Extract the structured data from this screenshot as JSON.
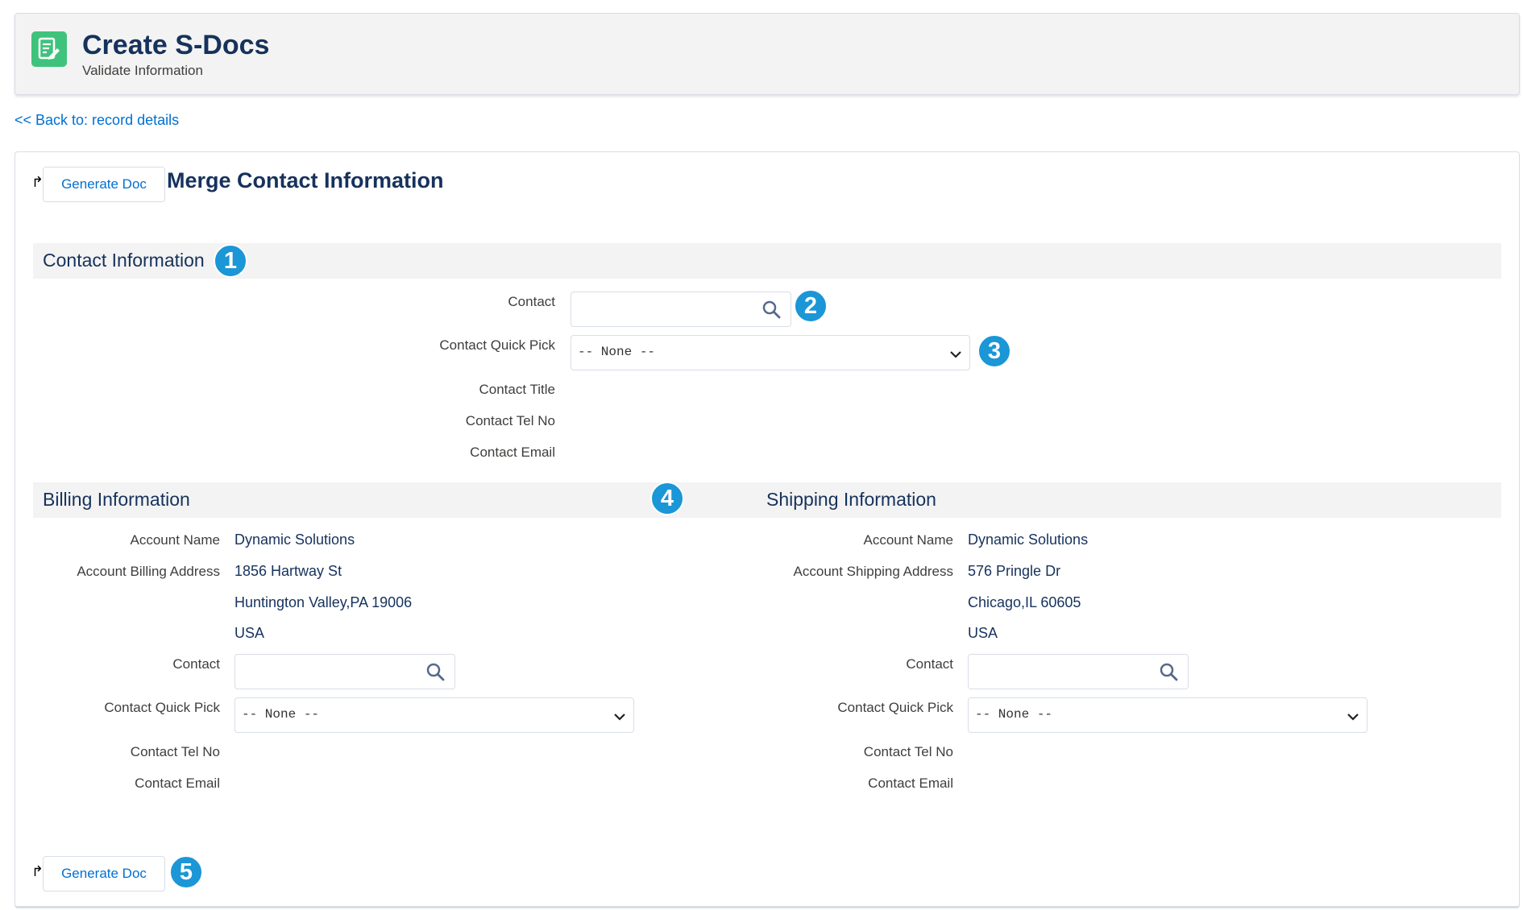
{
  "header": {
    "title": "Create S-Docs",
    "subtitle": "Validate Information"
  },
  "back_link": "<< Back to: record details",
  "generate_label": "Generate Doc",
  "merge_title": "Merge Contact Information",
  "contact_section": {
    "title": "Contact Information",
    "badge": "1",
    "contact_label": "Contact",
    "contact_value": "",
    "contact_badge": "2",
    "quick_pick_label": "Contact Quick Pick",
    "quick_pick_value": "-- None --",
    "quick_pick_badge": "3",
    "title_label": "Contact Title",
    "tel_label": "Contact Tel No",
    "email_label": "Contact Email"
  },
  "billing": {
    "title": "Billing Information",
    "account_name_label": "Account Name",
    "account_name": "Dynamic Solutions",
    "address_label": "Account Billing Address",
    "address_line1": "1856 Hartway St",
    "address_line2": "Huntington Valley,PA 19006",
    "address_line3": "USA",
    "contact_label": "Contact",
    "quick_pick_label": "Contact Quick Pick",
    "quick_pick_value": "-- None --",
    "tel_label": "Contact Tel No",
    "email_label": "Contact Email"
  },
  "middle_badge": "4",
  "shipping": {
    "title": "Shipping Information",
    "account_name_label": "Account Name",
    "account_name": "Dynamic Solutions",
    "address_label": "Account Shipping Address",
    "address_line1": "576 Pringle Dr",
    "address_line2": "Chicago,IL 60605",
    "address_line3": "USA",
    "contact_label": "Contact",
    "quick_pick_label": "Contact Quick Pick",
    "quick_pick_value": "-- None --",
    "tel_label": "Contact Tel No",
    "email_label": "Contact Email"
  },
  "bottom_badge": "5",
  "colors": {
    "accent": "#0070d2",
    "badge": "#1b96d6",
    "app_icon": "#3fc37c",
    "heading": "#16325c"
  },
  "icons": {
    "app": "document-edit-icon",
    "search": "search-icon",
    "chevron": "chevron-down-icon",
    "generate_arrow": "redirect-arrow-icon"
  }
}
